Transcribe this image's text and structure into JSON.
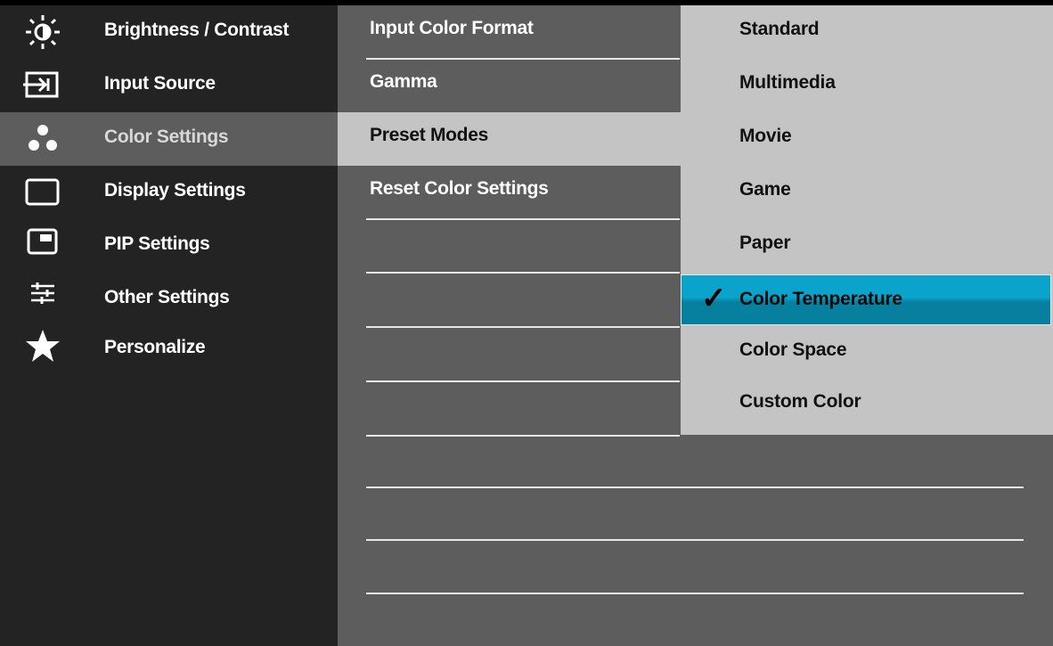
{
  "main_menu": [
    {
      "label": "Brightness / Contrast",
      "icon": "brightness-icon",
      "active": false
    },
    {
      "label": "Input Source",
      "icon": "input-source-icon",
      "active": false
    },
    {
      "label": "Color Settings",
      "icon": "color-settings-icon",
      "active": true
    },
    {
      "label": "Display Settings",
      "icon": "display-icon",
      "active": false
    },
    {
      "label": "PIP Settings",
      "icon": "pip-icon",
      "active": false
    },
    {
      "label": "Other Settings",
      "icon": "sliders-icon",
      "active": false
    },
    {
      "label": "Personalize",
      "icon": "star-icon",
      "active": false
    }
  ],
  "color_settings_menu": [
    {
      "label": "Input Color Format",
      "active": false
    },
    {
      "label": "Gamma",
      "active": false
    },
    {
      "label": "Preset Modes",
      "active": true
    },
    {
      "label": "Reset Color Settings",
      "active": false
    }
  ],
  "preset_modes": {
    "options": [
      "Standard",
      "Multimedia",
      "Movie",
      "Game",
      "Paper",
      "Color Temperature",
      "Color Space",
      "Custom Color"
    ],
    "selected": "Color Temperature",
    "check_glyph": "✓"
  },
  "colors": {
    "menu_bg": "#232323",
    "panel_bg": "#5d5d5d",
    "active_bg": "#c4c4c4",
    "highlight": "#0aa3cb"
  }
}
